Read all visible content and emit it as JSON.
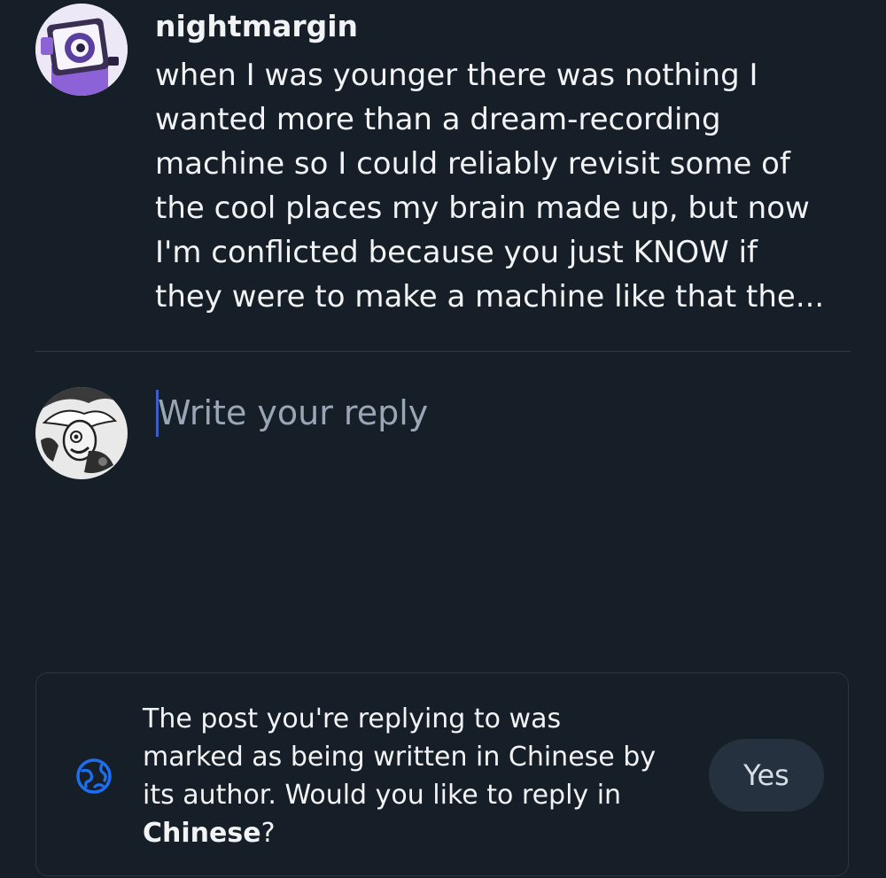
{
  "post": {
    "author": "nightmargin",
    "avatar_icon": "robot-eye-avatar",
    "text_lines": [
      "when I was younger there was nothing I",
      "wanted more than a dream-recording",
      "machine so I could reliably revisit some of",
      "the cool places my brain made up, but now",
      "I'm conflicted because you just KNOW if",
      "they were to make a machine like that the..."
    ]
  },
  "reply": {
    "avatar_icon": "comic-character-avatar",
    "placeholder": "Write your reply",
    "value": ""
  },
  "language_prompt": {
    "icon": "globe-icon",
    "lines": [
      "The post you're replying to was",
      "marked as being written in Chinese by",
      "its author. Would you like to reply in"
    ],
    "language": "Chinese",
    "suffix": "?",
    "yes_label": "Yes"
  },
  "colors": {
    "background": "#161e27",
    "text": "#f1f3f5",
    "placeholder": "#9aa6b6",
    "accent": "#1d6ff0",
    "button_bg": "#263140"
  }
}
